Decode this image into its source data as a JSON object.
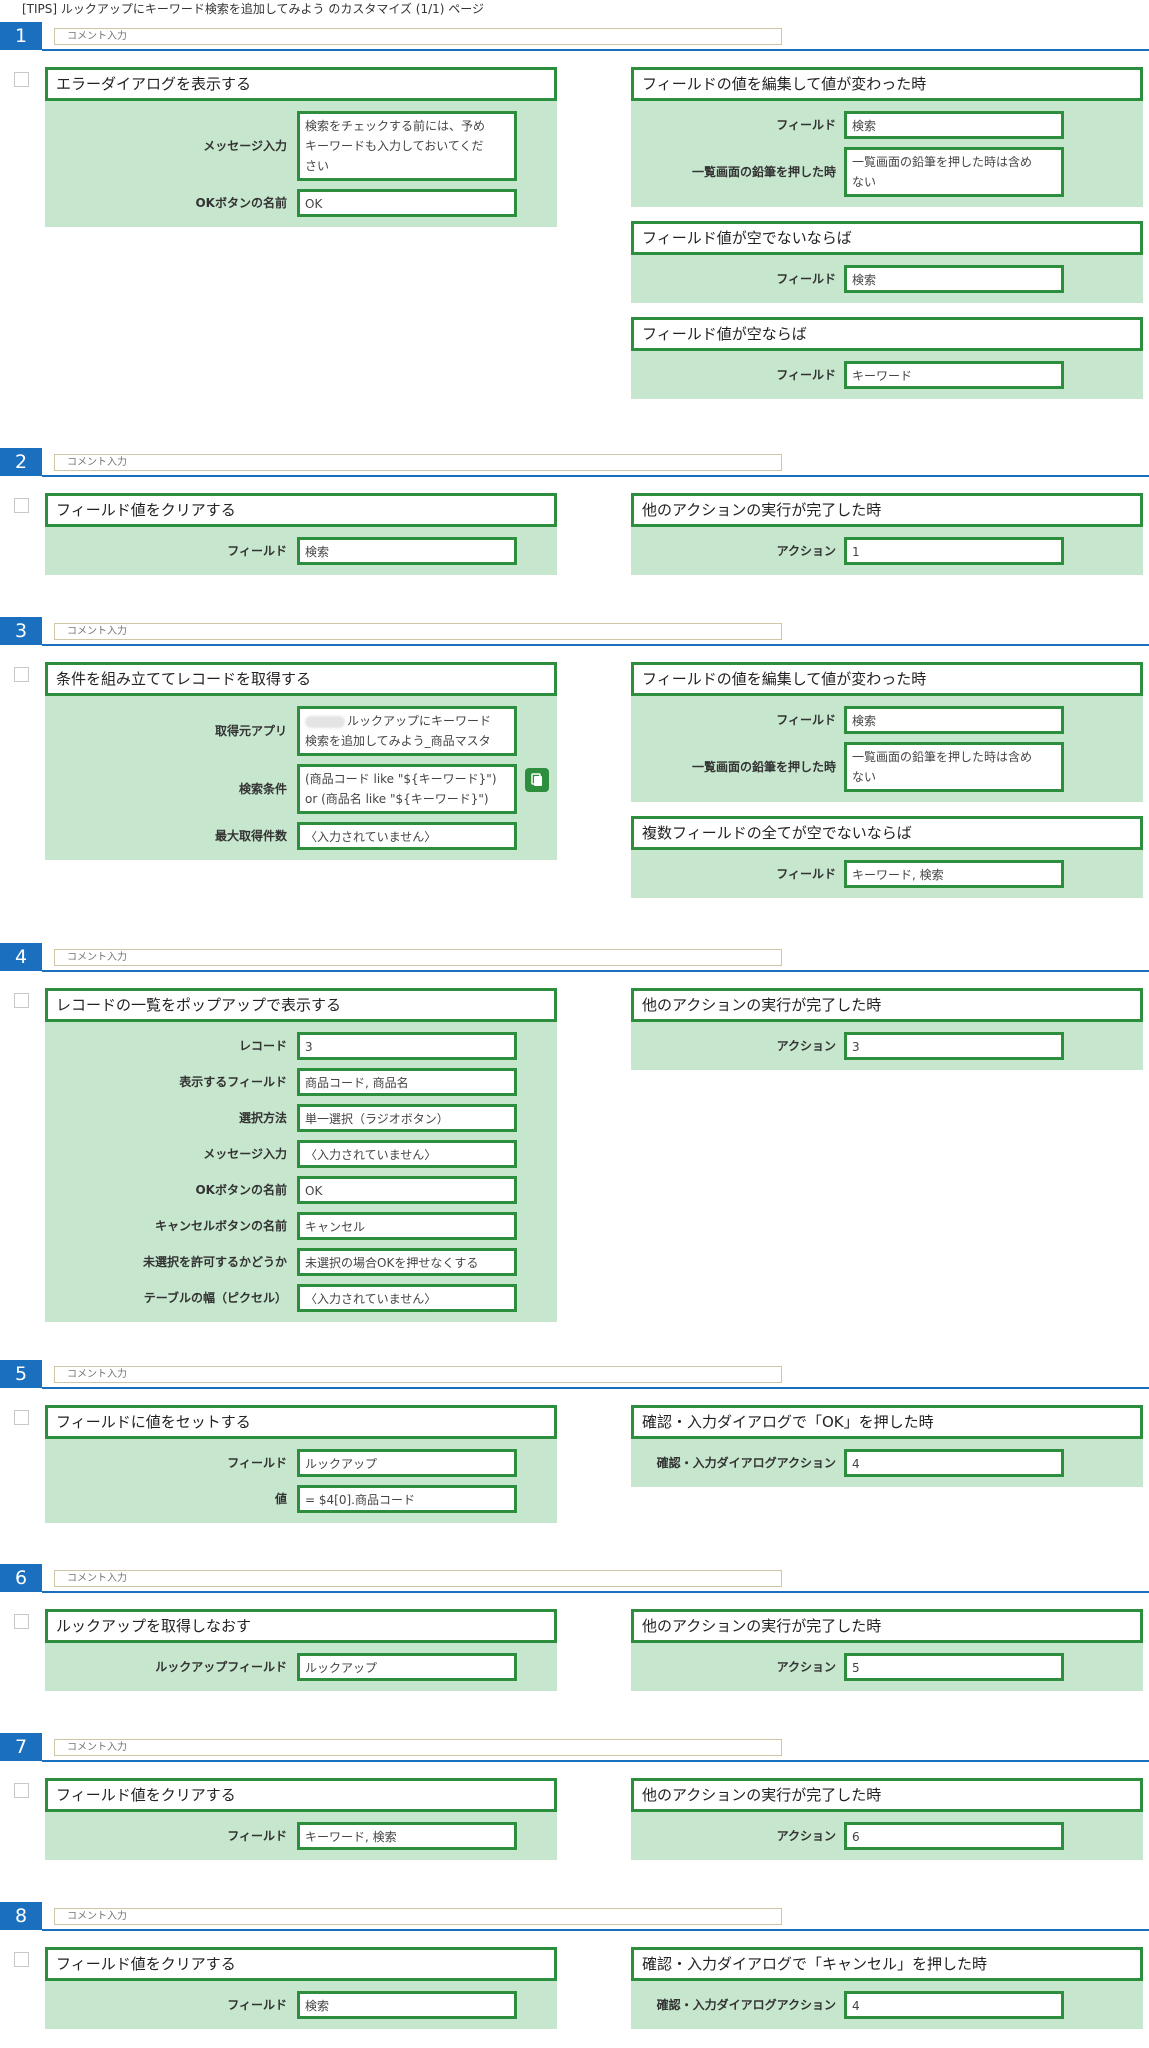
{
  "page_title": "[TIPS] ルックアップにキーワード検索を追加してみよう のカスタマイズ (1/1) ページ",
  "comment_placeholder": "コメント入力",
  "steps": [
    {
      "num": "1",
      "action": {
        "title": "エラーダイアログを表示する",
        "fields": [
          {
            "label": "メッセージ入力",
            "value": "検索をチェックする前には、予め\nキーワードも入力しておいてくだ\nさい"
          },
          {
            "label": "OKボタンの名前",
            "value": "OK"
          }
        ]
      },
      "triggers": [
        {
          "title": "フィールドの値を編集して値が変わった時",
          "fields": [
            {
              "label": "フィールド",
              "value": "検索"
            },
            {
              "label": "一覧画面の鉛筆を押した時",
              "value": "一覧画面の鉛筆を押した時は含め\nない"
            }
          ]
        },
        {
          "title": "フィールド値が空でないならば",
          "fields": [
            {
              "label": "フィールド",
              "value": "検索"
            }
          ]
        },
        {
          "title": "フィールド値が空ならば",
          "fields": [
            {
              "label": "フィールド",
              "value": "キーワード"
            }
          ]
        }
      ]
    },
    {
      "num": "2",
      "action": {
        "title": "フィールド値をクリアする",
        "fields": [
          {
            "label": "フィールド",
            "value": "検索"
          }
        ]
      },
      "triggers": [
        {
          "title": "他のアクションの実行が完了した時",
          "fields": [
            {
              "label": "アクション",
              "value": "1"
            }
          ]
        }
      ]
    },
    {
      "num": "3",
      "action": {
        "title": "条件を組み立ててレコードを取得する",
        "fields": [
          {
            "label": "取得元アプリ",
            "value": "ルックアップにキーワード\n検索を追加してみよう_商品マスタ"
          },
          {
            "label": "検索条件",
            "value": "(商品コード like \"${キーワード}\")\nor (商品名 like \"${キーワード}\")"
          },
          {
            "label": "最大取得件数",
            "value": "〈入力されていません〉"
          }
        ]
      },
      "triggers": [
        {
          "title": "フィールドの値を編集して値が変わった時",
          "fields": [
            {
              "label": "フィールド",
              "value": "検索"
            },
            {
              "label": "一覧画面の鉛筆を押した時",
              "value": "一覧画面の鉛筆を押した時は含め\nない"
            }
          ]
        },
        {
          "title": "複数フィールドの全てが空でないならば",
          "fields": [
            {
              "label": "フィールド",
              "value": "キーワード, 検索"
            }
          ]
        }
      ]
    },
    {
      "num": "4",
      "action": {
        "title": "レコードの一覧をポップアップで表示する",
        "fields": [
          {
            "label": "レコード",
            "value": "3"
          },
          {
            "label": "表示するフィールド",
            "value": "商品コード, 商品名"
          },
          {
            "label": "選択方法",
            "value": "単一選択（ラジオボタン）"
          },
          {
            "label": "メッセージ入力",
            "value": "〈入力されていません〉"
          },
          {
            "label": "OKボタンの名前",
            "value": "OK"
          },
          {
            "label": "キャンセルボタンの名前",
            "value": "キャンセル"
          },
          {
            "label": "未選択を許可するかどうか",
            "value": "未選択の場合OKを押せなくする"
          },
          {
            "label": "テーブルの幅（ピクセル）",
            "value": "〈入力されていません〉"
          }
        ]
      },
      "triggers": [
        {
          "title": "他のアクションの実行が完了した時",
          "fields": [
            {
              "label": "アクション",
              "value": "3"
            }
          ]
        }
      ]
    },
    {
      "num": "5",
      "action": {
        "title": "フィールドに値をセットする",
        "fields": [
          {
            "label": "フィールド",
            "value": "ルックアップ"
          },
          {
            "label": "値",
            "value": "= $4[0].商品コード"
          }
        ]
      },
      "triggers": [
        {
          "title": "確認・入力ダイアログで「OK」を押した時",
          "fields": [
            {
              "label": "確認・入力ダイアログアクション",
              "value": "4"
            }
          ]
        }
      ]
    },
    {
      "num": "6",
      "action": {
        "title": "ルックアップを取得しなおす",
        "fields": [
          {
            "label": "ルックアップフィールド",
            "value": "ルックアップ"
          }
        ]
      },
      "triggers": [
        {
          "title": "他のアクションの実行が完了した時",
          "fields": [
            {
              "label": "アクション",
              "value": "5"
            }
          ]
        }
      ]
    },
    {
      "num": "7",
      "action": {
        "title": "フィールド値をクリアする",
        "fields": [
          {
            "label": "フィールド",
            "value": "キーワード, 検索"
          }
        ]
      },
      "triggers": [
        {
          "title": "他のアクションの実行が完了した時",
          "fields": [
            {
              "label": "アクション",
              "value": "6"
            }
          ]
        }
      ]
    },
    {
      "num": "8",
      "action": {
        "title": "フィールド値をクリアする",
        "fields": [
          {
            "label": "フィールド",
            "value": "検索"
          }
        ]
      },
      "triggers": [
        {
          "title": "確認・入力ダイアログで「キャンセル」を押した時",
          "fields": [
            {
              "label": "確認・入力ダイアログアクション",
              "value": "4"
            }
          ]
        }
      ]
    }
  ]
}
